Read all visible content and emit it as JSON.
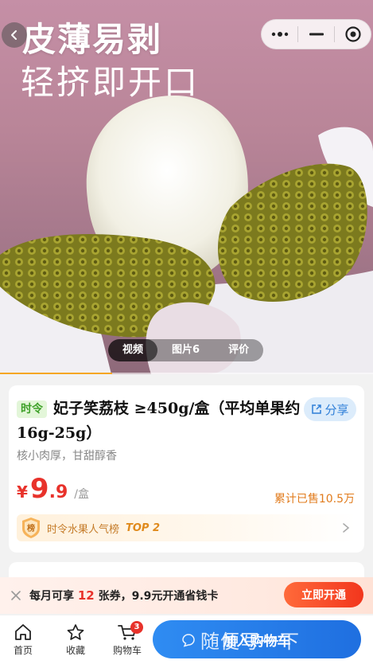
{
  "hero": {
    "title_line1": "皮薄易剥",
    "title_line2": "轻挤即开口",
    "media_tabs": [
      "视频",
      "图片6",
      "评价"
    ],
    "active_tab_index": 0,
    "carousel_progress": 0.3
  },
  "capsule": {
    "more_icon": "more-dots-icon",
    "minimize_icon": "minimize-icon",
    "close_icon": "target-close-icon"
  },
  "product": {
    "tag": "时令",
    "title": "妃子笑荔枝 ≥450g/盒（平均单果约16g-25g）",
    "share_label": "分享",
    "subtitle": "核小肉厚，甘甜醇香",
    "price_currency": "¥",
    "price_integer": "9",
    "price_decimal": ".9",
    "price_unit": "/盒",
    "sold": "累计已售10.5万",
    "rank_text": "时令水果人气榜",
    "rank_top": "TOP 2"
  },
  "promo": {
    "text_before": "每月可享 ",
    "count": "12",
    "text_after": " 张券，9.9元开通省钱卡",
    "button": "立即开通"
  },
  "bottom_nav": {
    "home": "首页",
    "favorite": "收藏",
    "cart": "购物车",
    "cart_count": "3",
    "add_to_cart": "加入购物车"
  },
  "watermark": {
    "text": "随便写一下"
  },
  "colors": {
    "accent_blue": "#1f6fe0",
    "price_red": "#e8322b",
    "tag_green": "#3fa12a",
    "sold_orange": "#e17b1c"
  }
}
